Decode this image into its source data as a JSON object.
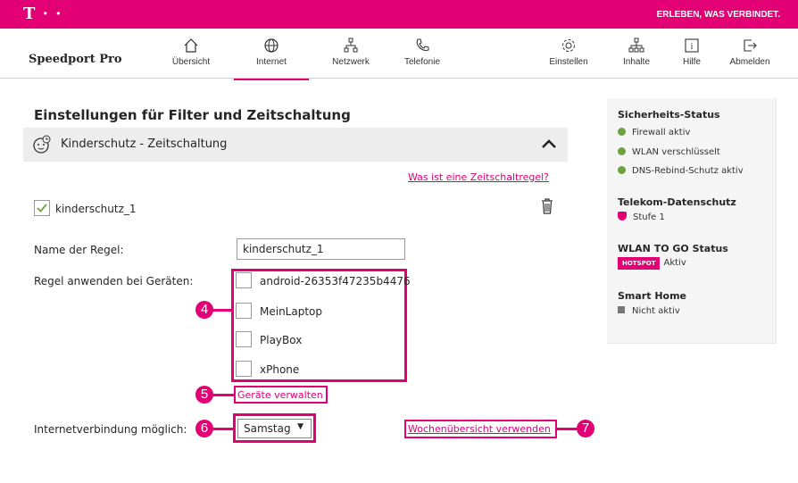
{
  "topbar": {
    "logo": "T · ·",
    "tagline": "ERLEBEN, WAS VERBINDET."
  },
  "navbar": {
    "brand": "Speedport Pro",
    "items": [
      {
        "label": "Übersicht",
        "icon": "home-icon"
      },
      {
        "label": "Internet",
        "icon": "globe-icon",
        "active": true
      },
      {
        "label": "Netzwerk",
        "icon": "network-icon"
      },
      {
        "label": "Telefonie",
        "icon": "phone-icon"
      },
      {
        "label": "Einstellen",
        "icon": "gear-icon"
      },
      {
        "label": "Inhalte",
        "icon": "content-icon"
      },
      {
        "label": "Hilfe",
        "icon": "help-icon"
      },
      {
        "label": "Abmelden",
        "icon": "logout-icon"
      }
    ]
  },
  "main": {
    "title": "Einstellungen für Filter und Zeitschaltung",
    "section_title": "Kinderschutz - Zeitschaltung",
    "help_link": "Was ist eine Zeitschaltregel?",
    "rule_checkbox_label": "kinderschutz_1",
    "name_label": "Name der Regel:",
    "name_value": "kinderschutz_1",
    "devices_label": "Regel anwenden bei Geräten:",
    "devices": [
      "android-26353f47235b4476",
      "MeinLaptop",
      "PlayBox",
      "xPhone"
    ],
    "manage_devices_link": "Geräte verwalten",
    "connection_label": "Internetverbindung möglich:",
    "day_select": "Samstag",
    "week_link": "Wochenübersicht verwenden",
    "callouts": [
      "4",
      "5",
      "6",
      "7"
    ]
  },
  "sidebar": {
    "security_title": "Sicherheits-Status",
    "security_items": [
      "Firewall aktiv",
      "WLAN verschlüsselt",
      "DNS-Rebind-Schutz aktiv"
    ],
    "privacy_title": "Telekom-Datenschutz",
    "privacy_value": "Stufe 1",
    "wlan_title": "WLAN TO GO Status",
    "wlan_badge": "HOTSPOT",
    "wlan_value": "Aktiv",
    "smarthome_title": "Smart Home",
    "smarthome_value": "Nicht aktiv"
  },
  "colors": {
    "brand": "#e20074",
    "status_ok": "#6ea140"
  }
}
